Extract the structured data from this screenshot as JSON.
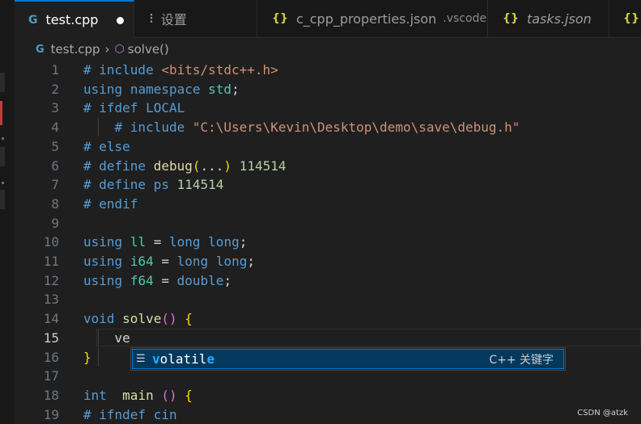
{
  "tabs": [
    {
      "label": "test.cpp",
      "icon": "cpp-file-icon",
      "dirty": true,
      "active": true
    },
    {
      "label": "设置",
      "icon": "settings-icon"
    },
    {
      "label": "c_cpp_properties.json",
      "description": ".vscode",
      "icon": "json-braces-icon"
    },
    {
      "label": "tasks.json",
      "icon": "json-braces-icon",
      "italic": true
    },
    {
      "label": "",
      "icon": "json-braces-icon"
    }
  ],
  "breadcrumb": {
    "file": "test.cpp",
    "symbol": "solve()"
  },
  "editor": {
    "current_line": 15,
    "lines": [
      {
        "n": "1"
      },
      {
        "n": "2"
      },
      {
        "n": "3"
      },
      {
        "n": "4"
      },
      {
        "n": "5"
      },
      {
        "n": "6"
      },
      {
        "n": "7"
      },
      {
        "n": "8"
      },
      {
        "n": "9"
      },
      {
        "n": "10"
      },
      {
        "n": "11"
      },
      {
        "n": "12"
      },
      {
        "n": "13"
      },
      {
        "n": "14"
      },
      {
        "n": "15"
      },
      {
        "n": "16"
      },
      {
        "n": "17"
      },
      {
        "n": "18"
      },
      {
        "n": "19"
      }
    ]
  },
  "suggest": {
    "icon": "keyword-icon",
    "label_match": "v",
    "label_mid": "olatil",
    "label_tail": "e",
    "detail": "C++ 关键字"
  },
  "colors": {
    "accent": "#0078d4",
    "selection": "#04395e",
    "background": "#1f1f1f"
  },
  "watermark": "CSDN @atzk"
}
